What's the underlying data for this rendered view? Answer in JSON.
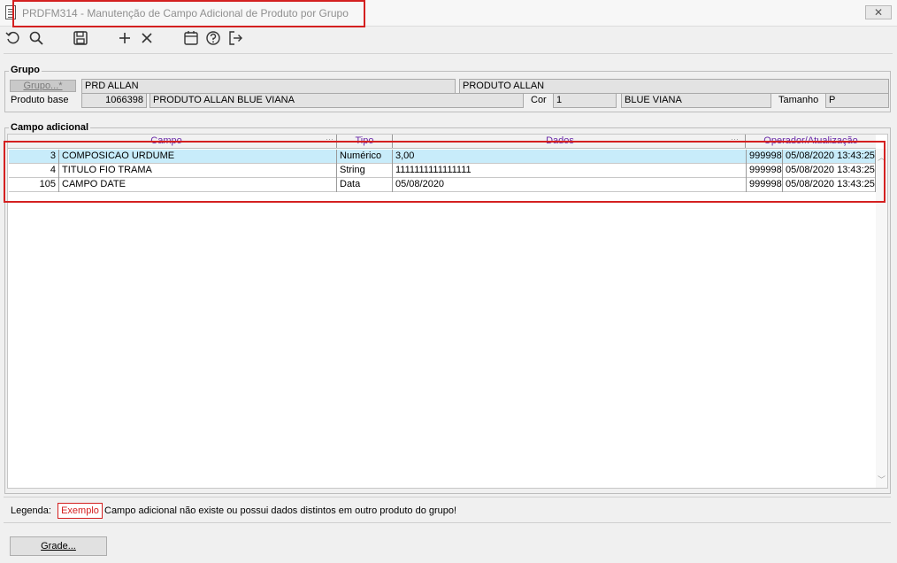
{
  "window": {
    "title": "PRDFM314 - Manutenção de Campo Adicional de Produto por Grupo",
    "close_symbol": "✕"
  },
  "toolbar": {
    "icons": [
      "undo-icon",
      "search-icon",
      "save-icon",
      "add-icon",
      "delete-icon",
      "calendar-icon",
      "help-icon",
      "exit-icon"
    ]
  },
  "grupo": {
    "section_title": "Grupo",
    "button_label": "Grupo...*",
    "code": "PRD ALLAN",
    "name": "PRODUTO ALLAN",
    "produto_base_label": "Produto base",
    "produto_base_code": "1066398",
    "produto_base_name": "PRODUTO ALLAN BLUE VIANA",
    "cor_label": "Cor",
    "cor_code": "1",
    "cor_name": "BLUE VIANA",
    "tamanho_label": "Tamanho",
    "tamanho_value": "P"
  },
  "campo_adicional": {
    "section_title": "Campo adicional",
    "columns": {
      "campo": "Campo",
      "tipo": "Tipo",
      "dados": "Dados",
      "operador": "Operador/Atualização"
    },
    "rows": [
      {
        "id": "3",
        "campo": "COMPOSICAO URDUME",
        "tipo": "Numérico",
        "dados": "3,00",
        "operador": "999998",
        "atualizacao": "05/08/2020 13:43:25",
        "selected": true
      },
      {
        "id": "4",
        "campo": "TITULO FIO TRAMA",
        "tipo": "String",
        "dados": "1111111111111111",
        "operador": "999998",
        "atualizacao": "05/08/2020 13:43:25",
        "selected": false
      },
      {
        "id": "105",
        "campo": "CAMPO DATE",
        "tipo": "Data",
        "dados": "05/08/2020",
        "operador": "999998",
        "atualizacao": "05/08/2020 13:43:25",
        "selected": false
      }
    ]
  },
  "legend": {
    "label": "Legenda:",
    "sample": "Exemplo",
    "description": "Campo adicional não existe ou possui dados distintos em outro produto do grupo!"
  },
  "footer": {
    "grade_button": "Grade..."
  },
  "colors": {
    "highlight": "#d42020",
    "selected_row": "#c8ecfa",
    "header_text": "#6a2aa8"
  }
}
